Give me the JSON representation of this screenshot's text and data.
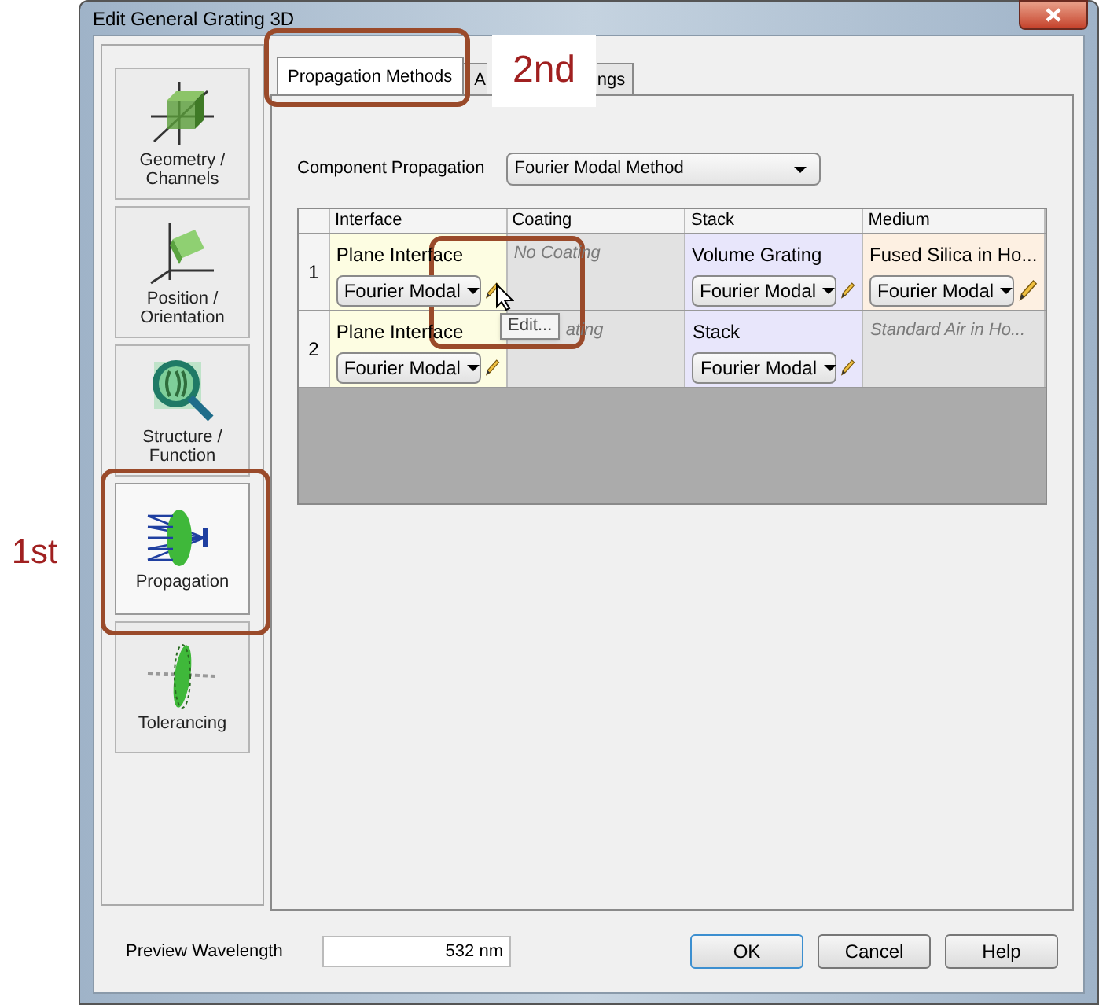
{
  "window": {
    "title": "Edit General Grating 3D"
  },
  "sidebar": {
    "items": [
      {
        "label": "Geometry / Channels",
        "kind": "geometry",
        "selected": false
      },
      {
        "label": "Position / Orientation",
        "kind": "position",
        "selected": false
      },
      {
        "label": "Structure / Function",
        "kind": "structure",
        "selected": false
      },
      {
        "label": "Propagation",
        "kind": "propagation",
        "selected": true
      },
      {
        "label": "Tolerancing",
        "kind": "tolerancing",
        "selected": false
      }
    ]
  },
  "tabs": [
    {
      "label": "Propagation Methods",
      "selected": true
    },
    {
      "label": "A",
      "label_end": "ngs",
      "selected": false
    }
  ],
  "component_propagation": {
    "label": "Component Propagation",
    "value": "Fourier Modal Method"
  },
  "table": {
    "columns": [
      "Interface",
      "Coating",
      "Stack",
      "Medium"
    ],
    "rows": [
      {
        "number": "1",
        "cells": [
          {
            "kind": "component",
            "name": "Plane Interface",
            "method": "Fourier Modal",
            "color": "#fdfde2"
          },
          {
            "kind": "empty",
            "name": "No Coating",
            "color": "#e2e2e2"
          },
          {
            "kind": "component",
            "name": "Volume Grating",
            "method": "Fourier Modal",
            "color": "#e8e6fb"
          },
          {
            "kind": "component",
            "name": "Fused Silica in Ho...",
            "method": "Fourier Modal",
            "color": "#fdf0e2"
          }
        ]
      },
      {
        "number": "2",
        "cells": [
          {
            "kind": "component",
            "name": "Plane Interface",
            "method": "Fourier Modal",
            "color": "#fdfde2"
          },
          {
            "kind": "covered",
            "name": "ating",
            "color": "#e2e2e2"
          },
          {
            "kind": "component",
            "name": "Stack",
            "method": "Fourier Modal",
            "color": "#e8e6fb"
          },
          {
            "kind": "empty",
            "name": "Standard Air in Ho...",
            "color": "#e2e2e2"
          }
        ]
      }
    ]
  },
  "tooltip": {
    "text": "Edit..."
  },
  "preview_wavelength": {
    "label": "Preview Wavelength",
    "value": "532 nm"
  },
  "buttons": [
    "OK",
    "Cancel",
    "Help"
  ],
  "annotations": [
    {
      "text": "1st"
    },
    {
      "text": "2nd"
    }
  ]
}
